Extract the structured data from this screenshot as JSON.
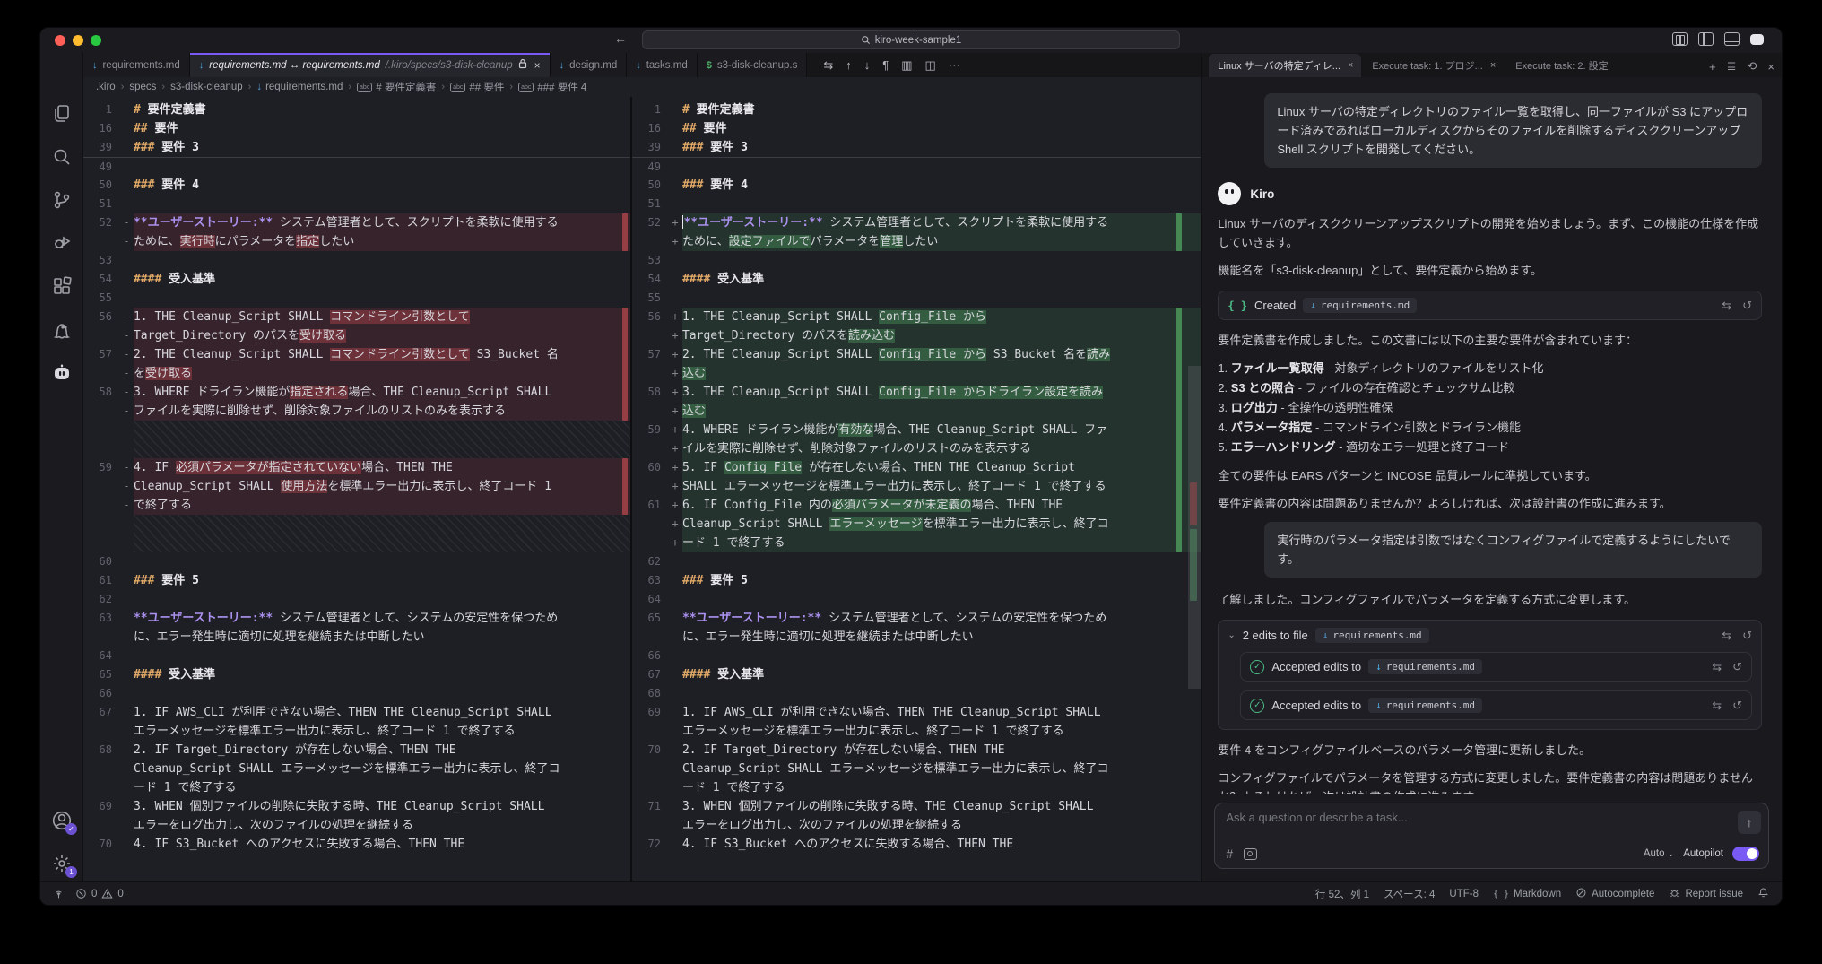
{
  "app": {
    "search": "kiro-week-sample1"
  },
  "tabs": [
    {
      "label": "requirements.md",
      "icon": "md"
    },
    {
      "label": "requirements.md ↔ requirements.md",
      "sub": "/.kiro/specs/s3-disk-cleanup",
      "icon": "md",
      "active": true,
      "lock": true,
      "close": "×"
    },
    {
      "label": "design.md",
      "icon": "md"
    },
    {
      "label": "tasks.md",
      "icon": "md"
    },
    {
      "label": "s3-disk-cleanup.s",
      "icon": "sh"
    }
  ],
  "editor_toolbar": [
    {
      "name": "open-changes-icon",
      "g": "⇆"
    },
    {
      "name": "previous-change-icon",
      "g": "↑"
    },
    {
      "name": "next-change-icon",
      "g": "↓"
    },
    {
      "name": "whitespace-icon",
      "g": "¶"
    },
    {
      "name": "map-icon",
      "g": "▥"
    },
    {
      "name": "split-editor-icon",
      "g": "◫"
    },
    {
      "name": "more-actions-icon",
      "g": "⋯"
    }
  ],
  "breadcrumb": [
    {
      "t": ".kiro"
    },
    {
      "t": "specs"
    },
    {
      "t": "s3-disk-cleanup"
    },
    {
      "t": "requirements.md",
      "icon": "md"
    },
    {
      "t": "# 要件定義書",
      "icon": "abc"
    },
    {
      "t": "## 要件",
      "icon": "abc"
    },
    {
      "t": "### 要件 4",
      "icon": "abc"
    }
  ],
  "left_rows": [
    {
      "n": "1",
      "seg": [
        [
          "# ",
          "kw"
        ],
        [
          "要件定義書",
          "w"
        ]
      ]
    },
    {
      "n": "16",
      "seg": [
        [
          "## ",
          "kw"
        ],
        [
          "要件",
          "w"
        ]
      ]
    },
    {
      "n": "39",
      "seg": [
        [
          "### ",
          "kw"
        ],
        [
          "要件 3",
          "w"
        ]
      ]
    },
    {
      "n": "49",
      "sep": 1,
      "seg": []
    },
    {
      "n": "50",
      "seg": [
        [
          "### ",
          "kw"
        ],
        [
          "要件 4",
          "w"
        ]
      ]
    },
    {
      "n": "51",
      "seg": []
    },
    {
      "n": "52",
      "m": "-",
      "bg": "del",
      "seg": [
        [
          "**ユーザーストーリー:**",
          "pu"
        ],
        [
          " システム管理者として、スクリプトを柔軟に使用する",
          "t"
        ]
      ]
    },
    {
      "m": "-",
      "bg": "del",
      "seg": [
        [
          "ために、",
          "t"
        ],
        [
          "実行時",
          "hl"
        ],
        [
          "にパラメータを",
          "t"
        ],
        [
          "指定",
          "hl"
        ],
        [
          "したい",
          "t"
        ]
      ]
    },
    {
      "n": "53",
      "seg": []
    },
    {
      "n": "54",
      "seg": [
        [
          "#### ",
          "kw"
        ],
        [
          "受入基準",
          "w"
        ]
      ]
    },
    {
      "n": "55",
      "seg": []
    },
    {
      "n": "56",
      "m": "-",
      "bg": "del",
      "seg": [
        [
          "1. THE Cleanup_Script SHALL ",
          "t"
        ],
        [
          "コマンドライン引数として",
          "hl"
        ]
      ]
    },
    {
      "m": "-",
      "bg": "del",
      "seg": [
        [
          "Target_Directory のパスを",
          "t"
        ],
        [
          "受け取る",
          "hl"
        ]
      ]
    },
    {
      "n": "57",
      "m": "-",
      "bg": "del",
      "seg": [
        [
          "2. THE Cleanup_Script SHALL ",
          "t"
        ],
        [
          "コマンドライン引数として",
          "hl"
        ],
        [
          " S3_Bucket 名",
          "t"
        ]
      ]
    },
    {
      "m": "-",
      "bg": "del",
      "seg": [
        [
          "を",
          "t"
        ],
        [
          "受け取る",
          "hl"
        ]
      ]
    },
    {
      "n": "58",
      "m": "-",
      "bg": "del",
      "seg": [
        [
          "3. WHERE ドライラン機能が",
          "t"
        ],
        [
          "指定される",
          "hl"
        ],
        [
          "場合、THE Cleanup_Script SHALL",
          "t"
        ]
      ]
    },
    {
      "m": "-",
      "bg": "del",
      "seg": [
        [
          "ファイルを実際に削除せず、削除対象ファイルのリストのみを表示する",
          "t"
        ]
      ]
    },
    {
      "bg": "hatch",
      "seg": []
    },
    {
      "bg": "hatch",
      "seg": []
    },
    {
      "n": "59",
      "m": "-",
      "bg": "del",
      "seg": [
        [
          "4. IF ",
          "t"
        ],
        [
          "必須パラメータが指定されていない",
          "hl"
        ],
        [
          "場合、THEN THE",
          "t"
        ]
      ]
    },
    {
      "m": "-",
      "bg": "del",
      "seg": [
        [
          "Cleanup_Script SHALL ",
          "t"
        ],
        [
          "使用方法",
          "hl"
        ],
        [
          "を標準エラー出力に表示し、終了コード 1",
          "t"
        ]
      ]
    },
    {
      "m": "-",
      "bg": "del",
      "seg": [
        [
          "で終了する",
          "t"
        ]
      ]
    },
    {
      "bg": "hatch",
      "seg": []
    },
    {
      "bg": "hatch",
      "seg": []
    },
    {
      "n": "60",
      "seg": []
    },
    {
      "n": "61",
      "seg": [
        [
          "### ",
          "kw"
        ],
        [
          "要件 5",
          "w"
        ]
      ]
    },
    {
      "n": "62",
      "seg": []
    },
    {
      "n": "63",
      "seg": [
        [
          "**ユーザーストーリー:**",
          "pu"
        ],
        [
          " システム管理者として、システムの安定性を保つため",
          "t"
        ]
      ]
    },
    {
      "seg": [
        [
          "に、エラー発生時に適切に処理を継続または中断したい",
          "t"
        ]
      ]
    },
    {
      "n": "64",
      "seg": []
    },
    {
      "n": "65",
      "seg": [
        [
          "#### ",
          "kw"
        ],
        [
          "受入基準",
          "w"
        ]
      ]
    },
    {
      "n": "66",
      "seg": []
    },
    {
      "n": "67",
      "seg": [
        [
          "1. IF AWS_CLI が利用できない場合、THEN THE Cleanup_Script SHALL",
          "t"
        ]
      ]
    },
    {
      "seg": [
        [
          "エラーメッセージを標準エラー出力に表示し、終了コード 1 で終了する",
          "t"
        ]
      ]
    },
    {
      "n": "68",
      "seg": [
        [
          "2. IF Target_Directory が存在しない場合、THEN THE",
          "t"
        ]
      ]
    },
    {
      "seg": [
        [
          "Cleanup_Script SHALL エラーメッセージを標準エラー出力に表示し、終了コ",
          "t"
        ]
      ]
    },
    {
      "seg": [
        [
          "ード 1 で終了する",
          "t"
        ]
      ]
    },
    {
      "n": "69",
      "seg": [
        [
          "3. WHEN 個別ファイルの削除に失敗する時、THE Cleanup_Script SHALL",
          "t"
        ]
      ]
    },
    {
      "seg": [
        [
          "エラーをログ出力し、次のファイルの処理を継続する",
          "t"
        ]
      ]
    },
    {
      "n": "70",
      "seg": [
        [
          "4. IF S3_Bucket へのアクセスに失敗する場合、THEN THE",
          "t"
        ]
      ]
    }
  ],
  "right_rows": [
    {
      "n": "1",
      "seg": [
        [
          "# ",
          "kw"
        ],
        [
          "要件定義書",
          "w"
        ]
      ]
    },
    {
      "n": "16",
      "seg": [
        [
          "## ",
          "kw"
        ],
        [
          "要件",
          "w"
        ]
      ]
    },
    {
      "n": "39",
      "seg": [
        [
          "### ",
          "kw"
        ],
        [
          "要件 3",
          "w"
        ]
      ]
    },
    {
      "n": "49",
      "sep": 1,
      "seg": []
    },
    {
      "n": "50",
      "seg": [
        [
          "### ",
          "kw"
        ],
        [
          "要件 4",
          "w"
        ]
      ]
    },
    {
      "n": "51",
      "seg": []
    },
    {
      "n": "52",
      "m": "+",
      "bg": "add",
      "cur": 1,
      "seg": [
        [
          "**ユーザーストーリー:**",
          "pu"
        ],
        [
          " システム管理者として、スクリプトを柔軟に使用する",
          "t"
        ]
      ]
    },
    {
      "m": "+",
      "bg": "add",
      "seg": [
        [
          "ために、",
          "t"
        ],
        [
          "設定ファイルで",
          "hl"
        ],
        [
          "パラメータを",
          "t"
        ],
        [
          "管理",
          "hl"
        ],
        [
          "したい",
          "t"
        ]
      ]
    },
    {
      "n": "53",
      "seg": []
    },
    {
      "n": "54",
      "seg": [
        [
          "#### ",
          "kw"
        ],
        [
          "受入基準",
          "w"
        ]
      ]
    },
    {
      "n": "55",
      "seg": []
    },
    {
      "n": "56",
      "m": "+",
      "bg": "add",
      "seg": [
        [
          "1. THE Cleanup_Script SHALL ",
          "t"
        ],
        [
          "Config_File から",
          "hl"
        ]
      ]
    },
    {
      "m": "+",
      "bg": "add",
      "seg": [
        [
          "Target_Directory のパスを",
          "t"
        ],
        [
          "読み込む",
          "hl"
        ]
      ]
    },
    {
      "n": "57",
      "m": "+",
      "bg": "add",
      "seg": [
        [
          "2. THE Cleanup_Script SHALL ",
          "t"
        ],
        [
          "Config_File から",
          "hl"
        ],
        [
          " S3_Bucket 名を",
          "t"
        ],
        [
          "読み",
          "hl"
        ]
      ]
    },
    {
      "m": "+",
      "bg": "add",
      "seg": [
        [
          "込む",
          "hl"
        ]
      ]
    },
    {
      "n": "58",
      "m": "+",
      "bg": "add",
      "seg": [
        [
          "3. THE Cleanup_Script SHALL ",
          "t"
        ],
        [
          "Config_File からドライラン設定を読み",
          "hl"
        ]
      ]
    },
    {
      "m": "+",
      "bg": "add",
      "seg": [
        [
          "込む",
          "hl"
        ]
      ]
    },
    {
      "n": "59",
      "m": "+",
      "bg": "add",
      "seg": [
        [
          "4. WHERE ドライラン機能が",
          "t"
        ],
        [
          "有効な",
          "hl"
        ],
        [
          "場合、THE Cleanup_Script SHALL ファ",
          "t"
        ]
      ]
    },
    {
      "m": "+",
      "bg": "add",
      "seg": [
        [
          "イルを実際に削除せず、削除対象ファイルのリストのみを表示する",
          "t"
        ]
      ]
    },
    {
      "n": "60",
      "m": "+",
      "bg": "add",
      "seg": [
        [
          "5. IF ",
          "t"
        ],
        [
          "Config_File",
          "hl"
        ],
        [
          " が存在しない場合、THEN THE Cleanup_Script",
          "t"
        ]
      ]
    },
    {
      "m": "+",
      "bg": "add",
      "seg": [
        [
          "SHALL エラーメッセージを標準エラー出力に表示し、終了コード 1 で終了する",
          "t"
        ]
      ]
    },
    {
      "n": "61",
      "m": "+",
      "bg": "add",
      "seg": [
        [
          "6. IF Config_File 内の",
          "t"
        ],
        [
          "必須パラメータが未定義の",
          "hl"
        ],
        [
          "場合、THEN THE",
          "t"
        ]
      ]
    },
    {
      "m": "+",
      "bg": "add",
      "seg": [
        [
          "Cleanup_Script SHALL ",
          "t"
        ],
        [
          "エラーメッセージ",
          "hl"
        ],
        [
          "を標準エラー出力に表示し、終了コ",
          "t"
        ]
      ]
    },
    {
      "m": "+",
      "bg": "add",
      "seg": [
        [
          "ード 1 で終了する",
          "t"
        ]
      ]
    },
    {
      "n": "62",
      "seg": []
    },
    {
      "n": "63",
      "seg": [
        [
          "### ",
          "kw"
        ],
        [
          "要件 5",
          "w"
        ]
      ]
    },
    {
      "n": "64",
      "seg": []
    },
    {
      "n": "65",
      "seg": [
        [
          "**ユーザーストーリー:**",
          "pu"
        ],
        [
          " システム管理者として、システムの安定性を保つため",
          "t"
        ]
      ]
    },
    {
      "seg": [
        [
          "に、エラー発生時に適切に処理を継続または中断したい",
          "t"
        ]
      ]
    },
    {
      "n": "66",
      "seg": []
    },
    {
      "n": "67",
      "seg": [
        [
          "#### ",
          "kw"
        ],
        [
          "受入基準",
          "w"
        ]
      ]
    },
    {
      "n": "68",
      "seg": []
    },
    {
      "n": "69",
      "seg": [
        [
          "1. IF AWS_CLI が利用できない場合、THEN THE Cleanup_Script SHALL",
          "t"
        ]
      ]
    },
    {
      "seg": [
        [
          "エラーメッセージを標準エラー出力に表示し、終了コード 1 で終了する",
          "t"
        ]
      ]
    },
    {
      "n": "70",
      "seg": [
        [
          "2. IF Target_Directory が存在しない場合、THEN THE",
          "t"
        ]
      ]
    },
    {
      "seg": [
        [
          "Cleanup_Script SHALL エラーメッセージを標準エラー出力に表示し、終了コ",
          "t"
        ]
      ]
    },
    {
      "seg": [
        [
          "ード 1 で終了する",
          "t"
        ]
      ]
    },
    {
      "n": "71",
      "seg": [
        [
          "3. WHEN 個別ファイルの削除に失敗する時、THE Cleanup_Script SHALL",
          "t"
        ]
      ]
    },
    {
      "seg": [
        [
          "エラーをログ出力し、次のファイルの処理を継続する",
          "t"
        ]
      ]
    },
    {
      "n": "72",
      "seg": [
        [
          "4. IF S3_Bucket へのアクセスに失敗する場合、THEN THE",
          "t"
        ]
      ]
    }
  ],
  "chat": {
    "tabs": [
      {
        "label": "Linux サーバの特定ディレ...",
        "active": true,
        "close": "×"
      },
      {
        "label": "Execute task: 1. プロジ...",
        "close": "×"
      },
      {
        "label": "Execute task: 2. 設定"
      }
    ],
    "controls": [
      {
        "name": "new-session-icon",
        "g": "+"
      },
      {
        "name": "task-list-icon",
        "g": "≣"
      },
      {
        "name": "history-icon",
        "g": "⟲"
      },
      {
        "name": "close-panel-icon",
        "g": "×"
      }
    ],
    "messages": [
      {
        "type": "user",
        "text": "Linux サーバの特定ディレクトリのファイル一覧を取得し、同一ファイルが S3 にアップロード済みであればローカルディスクからそのファイルを削除するディスククリーンアップ Shell スクリプトを開発してください。"
      },
      {
        "type": "head",
        "name": "Kiro"
      },
      {
        "type": "p",
        "text": "Linux サーバのディスククリーンアップスクリプトの開発を始めましょう。まず、この機能の仕様を作成していきます。"
      },
      {
        "type": "p",
        "text": "機能名を「s3-disk-cleanup」として、要件定義から始めます。"
      },
      {
        "type": "created",
        "label": "Created",
        "file": "requirements.md"
      },
      {
        "type": "p",
        "text": "要件定義書を作成しました。この文書には以下の主要な要件が含まれています："
      },
      {
        "type": "ol",
        "items": [
          {
            "n": "1. ",
            "b": "ファイル一覧取得",
            "t": " - 対象ディレクトリのファイルをリスト化"
          },
          {
            "n": "2. ",
            "b": "S3 との照合",
            "t": " - ファイルの存在確認とチェックサム比較"
          },
          {
            "n": "3. ",
            "b": "ログ出力",
            "t": " - 全操作の透明性確保"
          },
          {
            "n": "4. ",
            "b": "パラメータ指定",
            "t": " - コマンドライン引数とドライラン機能"
          },
          {
            "n": "5. ",
            "b": "エラーハンドリング",
            "t": " - 適切なエラー処理と終了コード"
          }
        ]
      },
      {
        "type": "p",
        "text": "全ての要件は EARS パターンと INCOSE 品質ルールに準拠しています。"
      },
      {
        "type": "p",
        "text": "要件定義書の内容は問題ありませんか？よろしければ、次は設計書の作成に進みます。"
      },
      {
        "type": "user",
        "text": "実行時のパラメータ指定は引数ではなくコンフィグファイルで定義するようにしたいです。"
      },
      {
        "type": "p",
        "text": "了解しました。コンフィグファイルでパラメータを定義する方式に変更します。"
      },
      {
        "type": "edits",
        "label": "2 edits to file",
        "file": "requirements.md",
        "accepted": [
          {
            "label": "Accepted edits to",
            "file": "requirements.md"
          },
          {
            "label": "Accepted edits to",
            "file": "requirements.md"
          }
        ]
      },
      {
        "type": "p",
        "text": "要件 4 をコンフィグファイルベースのパラメータ管理に更新しました。"
      },
      {
        "type": "p",
        "text": "コンフィグファイルでパラメータを管理する方式に変更しました。要件定義書の内容は問題ありませんか？よろしければ、次は設計書の作成に進みます。"
      }
    ],
    "input": {
      "placeholder": "Ask a question or describe a task...",
      "send": "↑",
      "hash": "#",
      "mode": "Auto",
      "mode_chev": "⌄",
      "autopilot_label": "Autopilot"
    }
  },
  "statusbar": {
    "errors": "0",
    "warnings": "0",
    "items": [
      {
        "t": "行 52、列 1"
      },
      {
        "t": "スペース: 4"
      },
      {
        "t": "UTF-8"
      },
      {
        "icon": "braces",
        "t": "Markdown"
      },
      {
        "icon": "slash",
        "t": "Autocomplete"
      },
      {
        "icon": "bug",
        "t": "Report issue"
      },
      {
        "icon": "bell",
        "t": ""
      }
    ]
  },
  "colors": {
    "accent": "#7a5af5",
    "added": "#48a05e",
    "deleted": "#d84a54",
    "green": "#4cba84",
    "md_icon": "#4fa3d8",
    "sh_icon": "#4eb06a"
  }
}
